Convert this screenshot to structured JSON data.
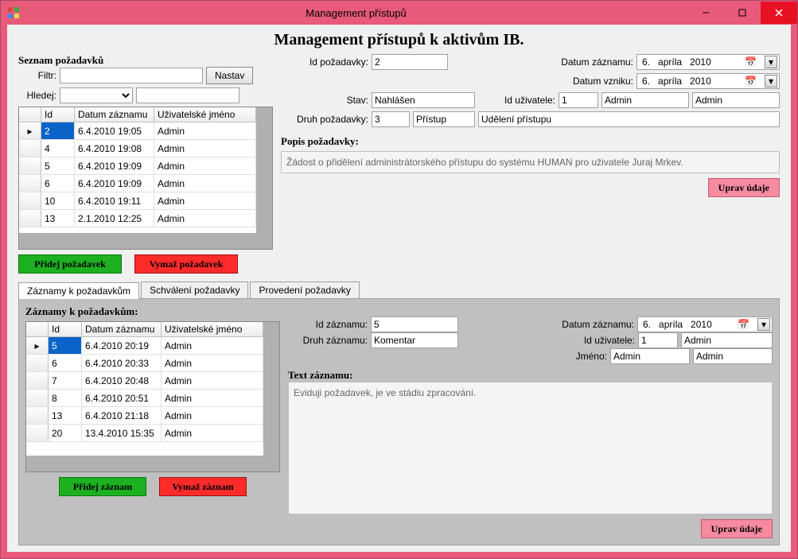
{
  "window": {
    "title": "Management přístupů"
  },
  "heading": "Management přístupů k aktivům IB.",
  "left": {
    "list_label": "Seznam požadavků",
    "filter_label": "Filtr:",
    "filter_value": "",
    "set_btn": "Nastav",
    "search_label": "Hledej:",
    "search_select": "",
    "search_value": "",
    "cols": {
      "id": "Id",
      "date": "Datum záznamu",
      "user": "Uživatelské jméno"
    },
    "rows": [
      {
        "id": "2",
        "date": "6.4.2010 19:05",
        "user": "Admin",
        "selected": true
      },
      {
        "id": "4",
        "date": "6.4.2010 19:08",
        "user": "Admin"
      },
      {
        "id": "5",
        "date": "6.4.2010 19:09",
        "user": "Admin"
      },
      {
        "id": "6",
        "date": "6.4.2010 19:09",
        "user": "Admin"
      },
      {
        "id": "10",
        "date": "6.4.2010 19:11",
        "user": "Admin"
      },
      {
        "id": "13",
        "date": "2.1.2010 12:25",
        "user": "Admin"
      }
    ],
    "add_btn": "Přidej požadavek",
    "del_btn": "Vymaž požadavek"
  },
  "detail": {
    "id_label": "Id požadavky:",
    "id": "2",
    "date_rec_label": "Datum záznamu:",
    "date_rec": {
      "d": "6.",
      "m": "apríla",
      "y": "2010"
    },
    "date_cre_label": "Datum vzniku:",
    "date_cre": {
      "d": "6.",
      "m": "apríla",
      "y": "2010"
    },
    "state_label": "Stav:",
    "state": "Nahlášen",
    "userid_label": "Id uživatele:",
    "userid": "1",
    "user1": "Admin",
    "user2": "Admin",
    "kind_label": "Druh požadavky:",
    "kind_id": "3",
    "kind_name": "Přístup",
    "kind_desc": "Udělení přístupu",
    "desc_label": "Popis požadavky:",
    "desc_text": "Žádost o přidělení administrátorského přístupu do systému HUMAN pro uživatele Juraj Mrkev.",
    "edit_btn": "Uprav údaje"
  },
  "tabs": {
    "t1": "Záznamy k požadavkům",
    "t2": "Schválení požadavky",
    "t3": "Provedení požadavky"
  },
  "sub": {
    "title": "Záznamy k požadavkům:",
    "cols": {
      "id": "Id",
      "date": "Datum záznamu",
      "user": "Uživatelské jméno"
    },
    "rows": [
      {
        "id": "5",
        "date": "6.4.2010 20:19",
        "user": "Admin",
        "selected": true
      },
      {
        "id": "6",
        "date": "6.4.2010 20:33",
        "user": "Admin"
      },
      {
        "id": "7",
        "date": "6.4.2010 20:48",
        "user": "Admin"
      },
      {
        "id": "8",
        "date": "6.4.2010 20:51",
        "user": "Admin"
      },
      {
        "id": "13",
        "date": "6.4.2010 21:18",
        "user": "Admin"
      },
      {
        "id": "20",
        "date": "13.4.2010 15:35",
        "user": "Admin"
      }
    ],
    "add_btn": "Přidej záznam",
    "del_btn": "Vymaž záznam",
    "id_label": "Id záznamu:",
    "id": "5",
    "kind_label": "Druh záznamu:",
    "kind": "Komentar",
    "date_label": "Datum záznamu:",
    "date": {
      "d": "6.",
      "m": "apríla",
      "y": "2010"
    },
    "userid_label": "Id uživatele:",
    "userid": "1",
    "user1": "Admin",
    "name_label": "Jméno:",
    "name1": "Admin",
    "name2": "Admin",
    "text_label": "Text záznamu:",
    "text_value": "Eviduji požadavek, je ve stádiu zpracování.",
    "edit_btn": "Uprav údaje"
  }
}
